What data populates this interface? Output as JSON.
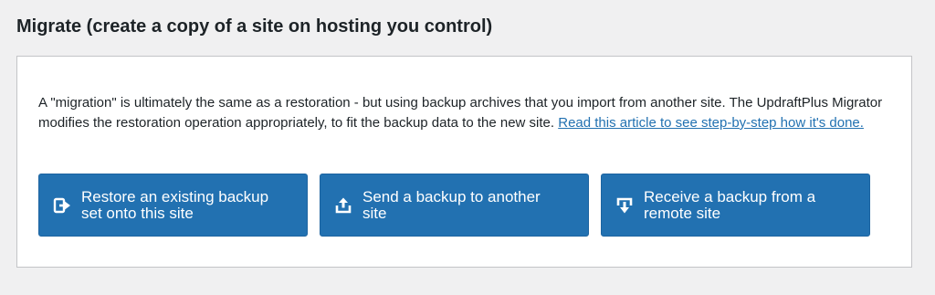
{
  "page": {
    "title": "Migrate (create a copy of a site on hosting you control)"
  },
  "description": {
    "text": "A \"migration\" is ultimately the same as a restoration - but using backup archives that you import from another site. The UpdraftPlus Migrator modifies the restoration operation appropriately, to fit the backup data to the new site. ",
    "link_text": "Read this article to see step-by-step how it's done."
  },
  "buttons": [
    {
      "label": "Restore an existing backup set onto this site",
      "icon": "restore-icon"
    },
    {
      "label": "Send a backup to another site",
      "icon": "upload-icon"
    },
    {
      "label": "Receive a backup from a remote site",
      "icon": "download-icon"
    }
  ],
  "colors": {
    "button_bg": "#2271b1",
    "link": "#2271b1",
    "background": "#f0f0f1"
  }
}
